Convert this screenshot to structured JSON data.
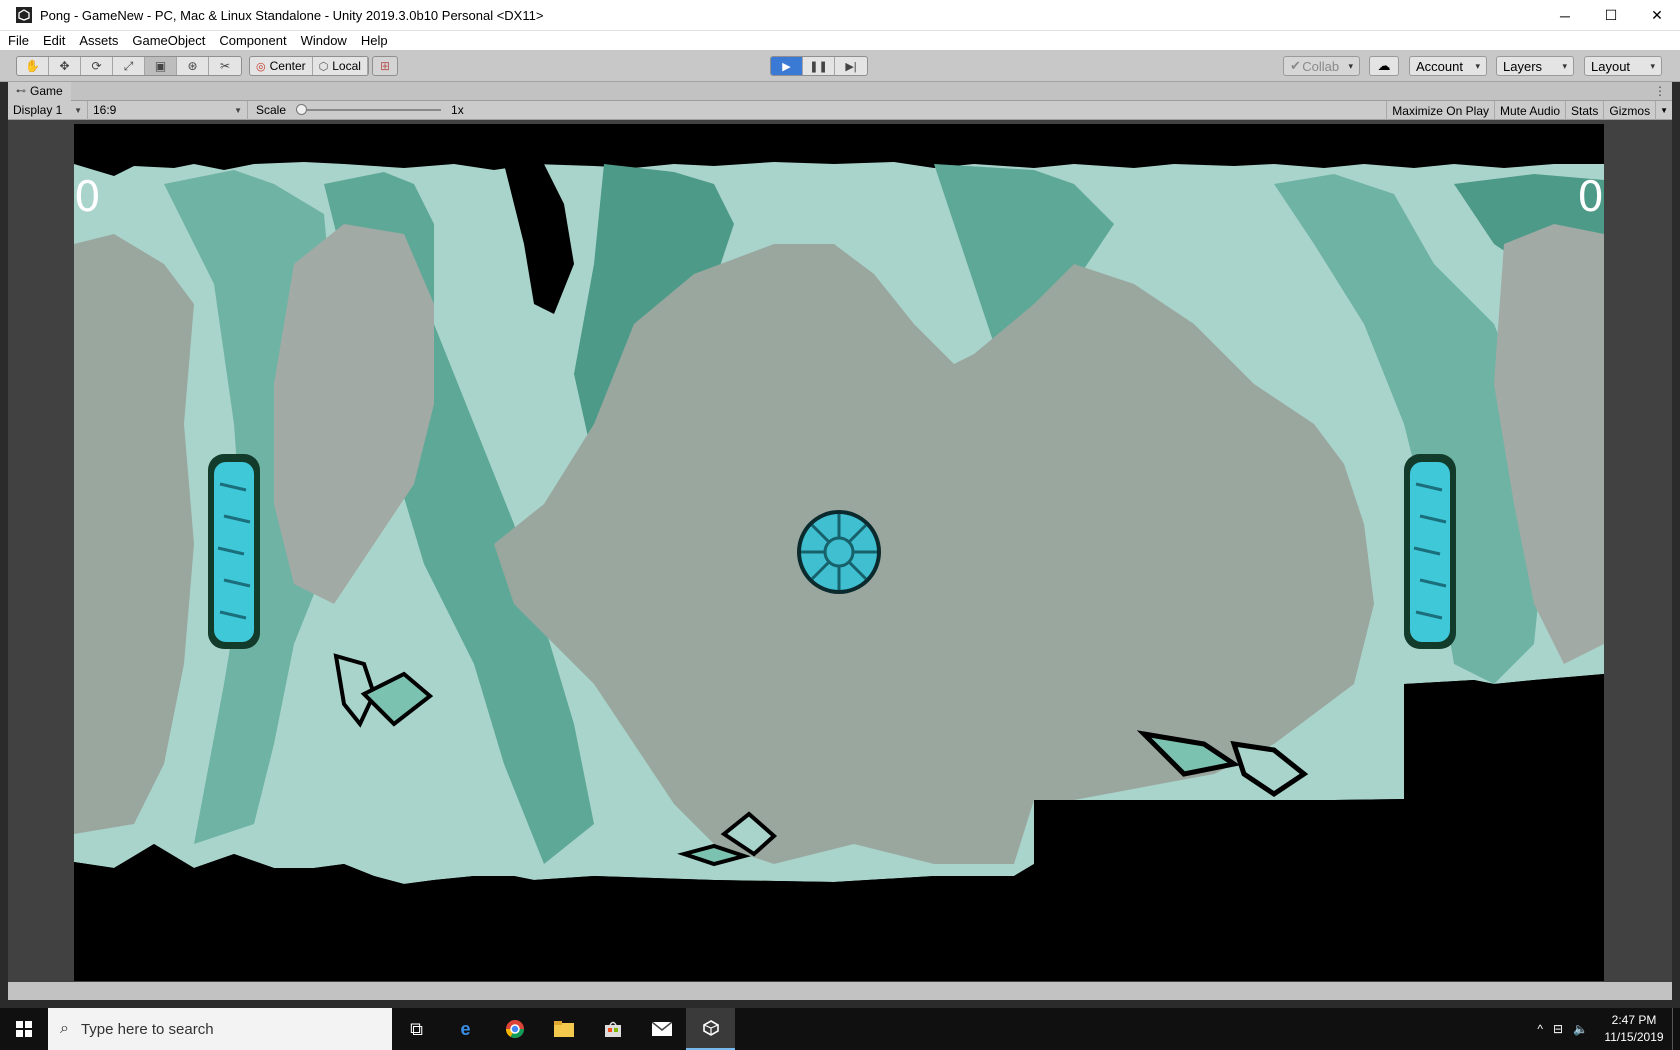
{
  "window": {
    "title": "Pong - GameNew - PC, Mac & Linux Standalone - Unity 2019.3.0b10 Personal <DX11>",
    "minimize": "─",
    "maximize": "☐",
    "close": "✕"
  },
  "menu": [
    "File",
    "Edit",
    "Assets",
    "GameObject",
    "Component",
    "Window",
    "Help"
  ],
  "toolbar": {
    "pivot_mode": "Center",
    "pivot_rotation": "Local",
    "collab": "Collab",
    "account": "Account",
    "layers": "Layers",
    "layout": "Layout",
    "play_active": true
  },
  "game_tab": {
    "label": "Game",
    "display": "Display 1",
    "aspect": "16:9",
    "scale_label": "Scale",
    "scale_value": "1x",
    "scale_fraction": 0,
    "buttons": [
      "Maximize On Play",
      "Mute Audio",
      "Stats",
      "Gizmos"
    ]
  },
  "game": {
    "score_left": "0",
    "score_right": "0",
    "colors": {
      "background": "#000000",
      "cave_light": "#a9d4cc",
      "cave_mid": "#6fb3a4",
      "cave_dark": "#4d9a88",
      "center_gray": "#9aa79f",
      "paddle": "#3fc8d8",
      "ball": "#3fbfd0"
    }
  },
  "taskbar": {
    "search_placeholder": "Type here to search",
    "time": "2:47 PM",
    "date": "11/15/2019",
    "icons": [
      "task-view-icon",
      "edge-icon",
      "chrome-icon",
      "file-explorer-icon",
      "store-icon",
      "mail-icon",
      "unity-icon"
    ]
  }
}
